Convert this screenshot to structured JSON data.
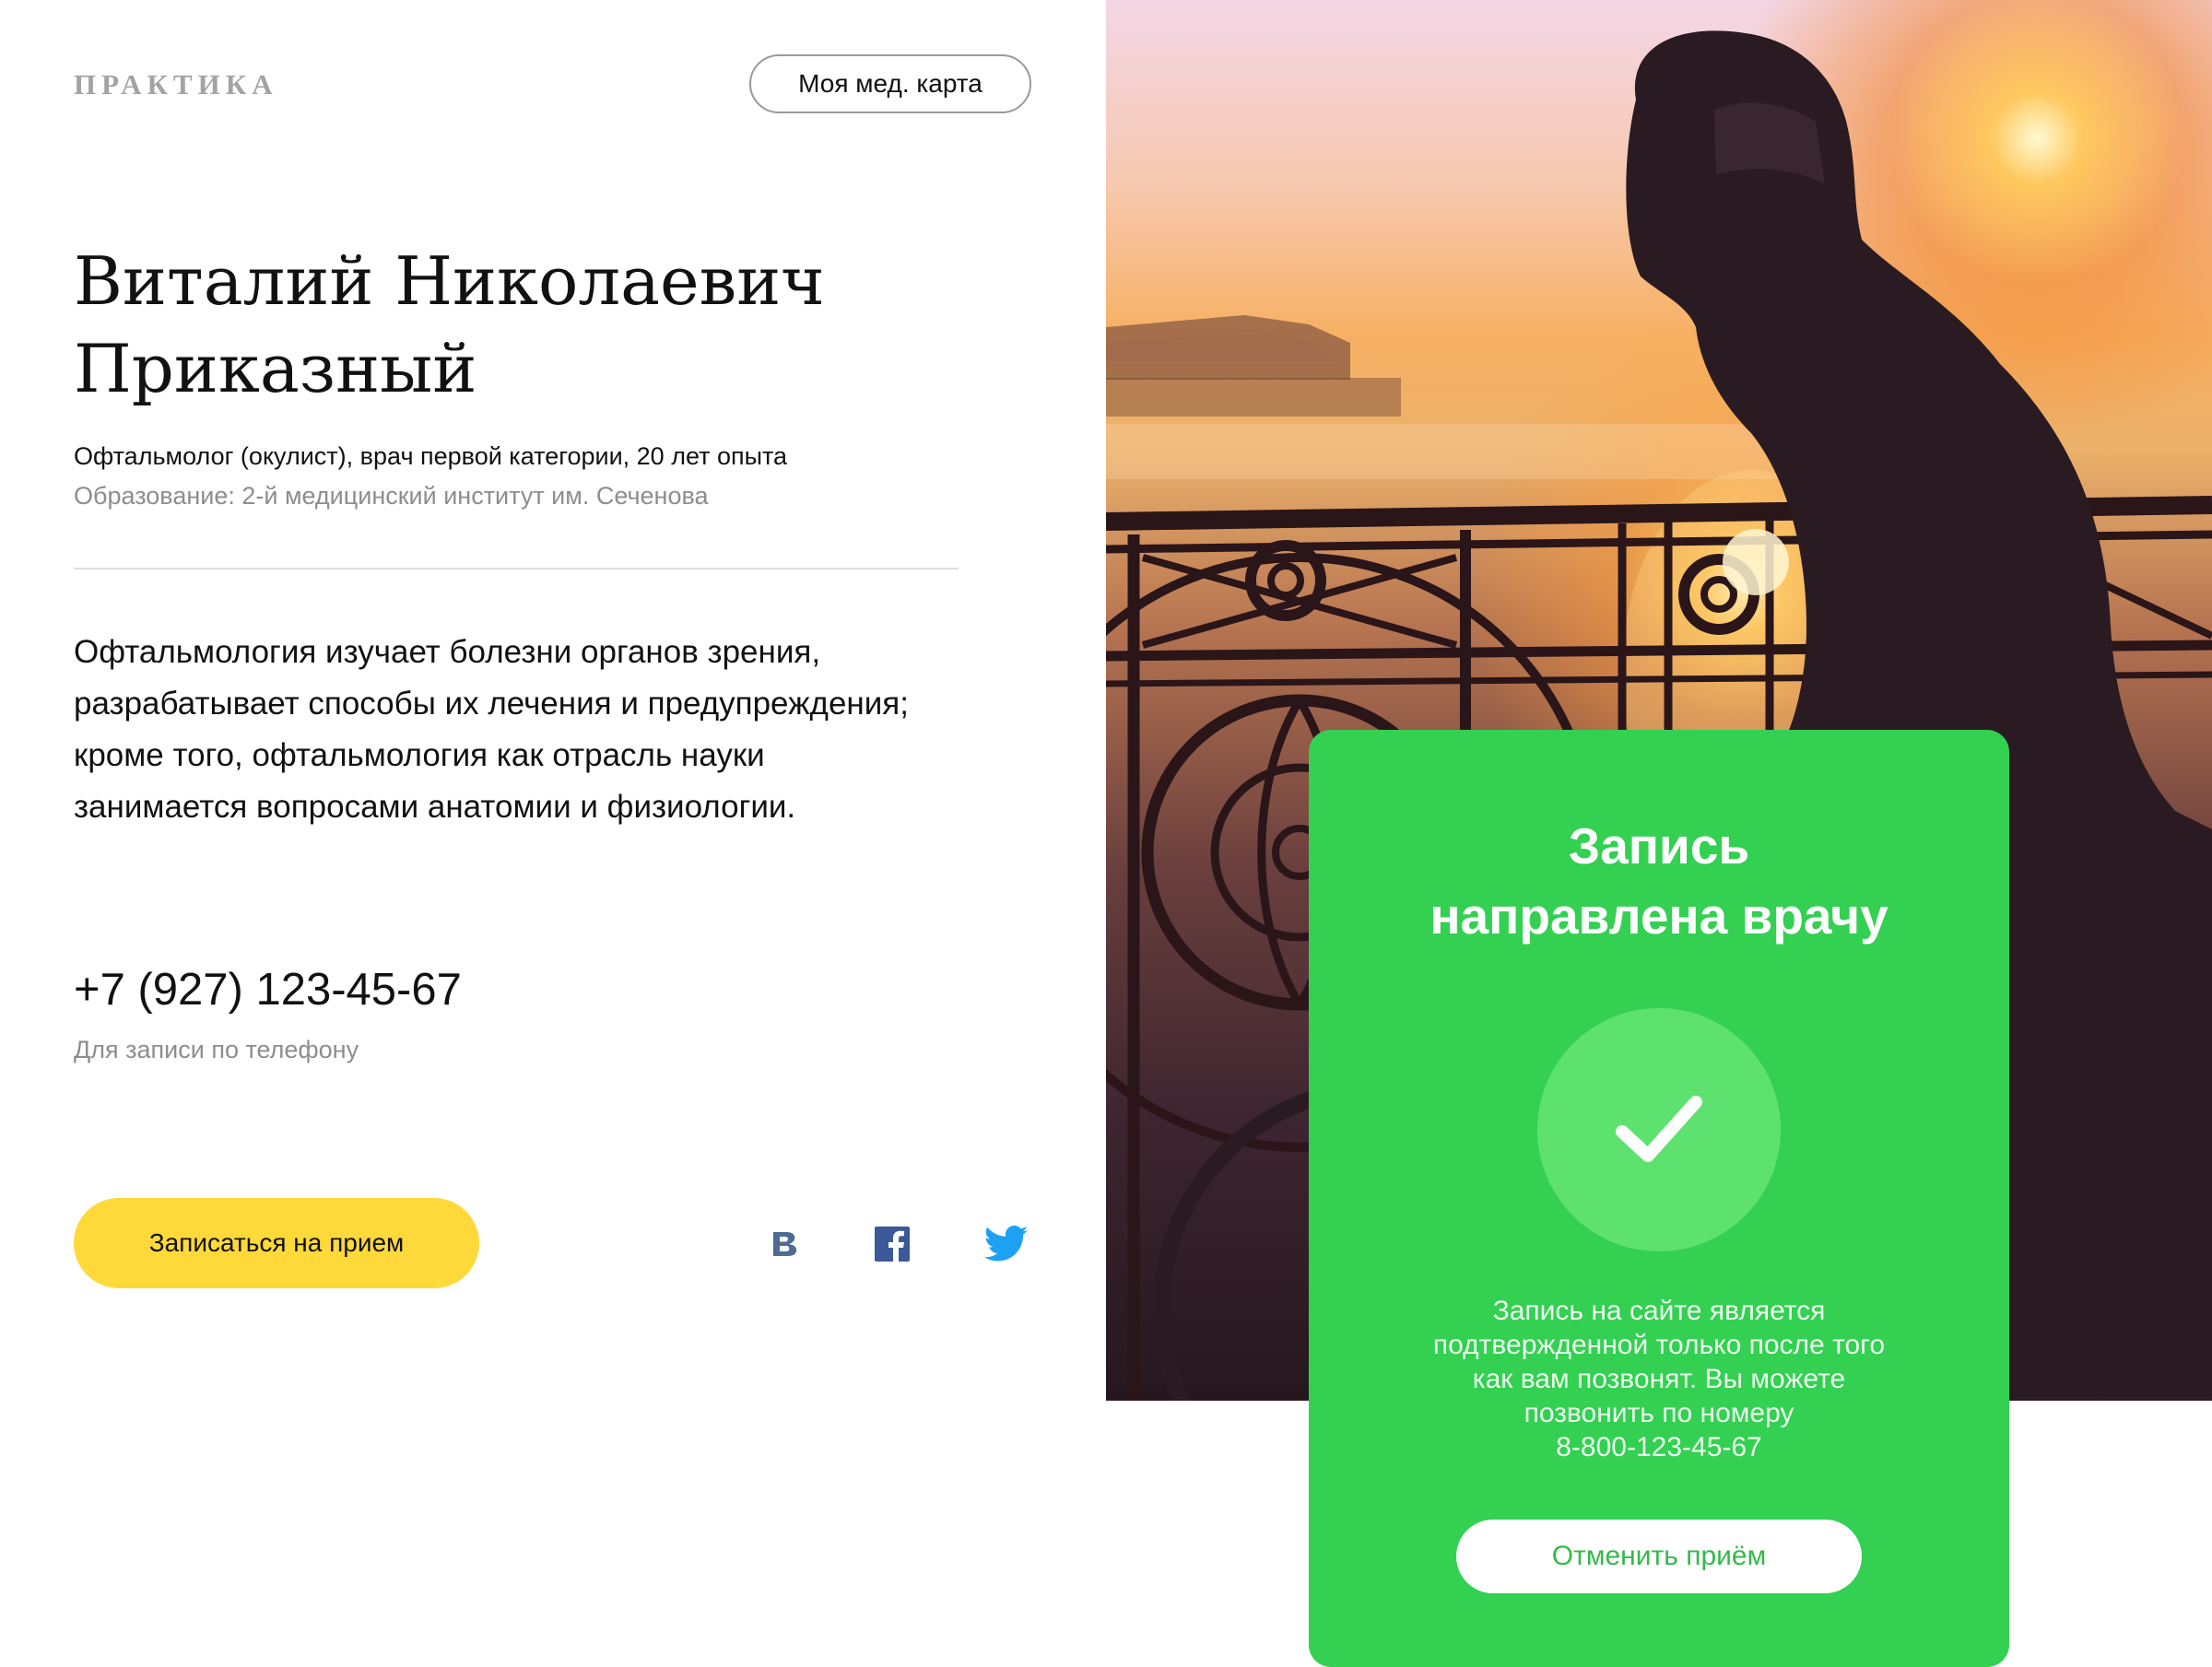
{
  "header": {
    "logo": "ПРАКТИКА",
    "med_card_button": "Моя мед. карта"
  },
  "doctor": {
    "name_lines": [
      "Виталий Николаевич",
      "Приказный"
    ],
    "specialty": "Офтальмолог (окулист), врач первой категории, 20 лет опыта",
    "education": "Образование: 2-й медицинский институт им. Сеченова",
    "description_lines": [
      "Офтальмология изучает болезни органов зрения,",
      "разрабатывает способы их лечения и предупреждения;",
      "кроме того, офтальмология как отрасль науки",
      "занимается вопросами анатомии и физиологии."
    ]
  },
  "contact": {
    "phone": "+7 (927) 123-45-67",
    "phone_note": "Для записи по телефону"
  },
  "actions": {
    "appointment_button": "Записаться на прием"
  },
  "social": [
    {
      "icon": "vk-icon",
      "color": "#4c6c91"
    },
    {
      "icon": "facebook-icon",
      "color": "#3b5998"
    },
    {
      "icon": "twitter-icon",
      "color": "#1da1f2"
    }
  ],
  "photo": {
    "icon": "cyclist-bridge-photo"
  },
  "status_card": {
    "title_lines": [
      "Запись",
      "направлена врачу"
    ],
    "check_icon": "checkmark-icon",
    "note_lines": [
      "Запись на сайте является",
      "подтвержденной только после того",
      "как вам позвонят. Вы можете",
      "позвонить по номеру",
      "8-800-123-45-67"
    ],
    "cancel_button": "Отменить приём"
  },
  "colors": {
    "accent_yellow": "#ffd93a",
    "success_green": "#33d052",
    "check_circle_green": "#5ee26f",
    "cancel_text_green": "#35b94b"
  }
}
